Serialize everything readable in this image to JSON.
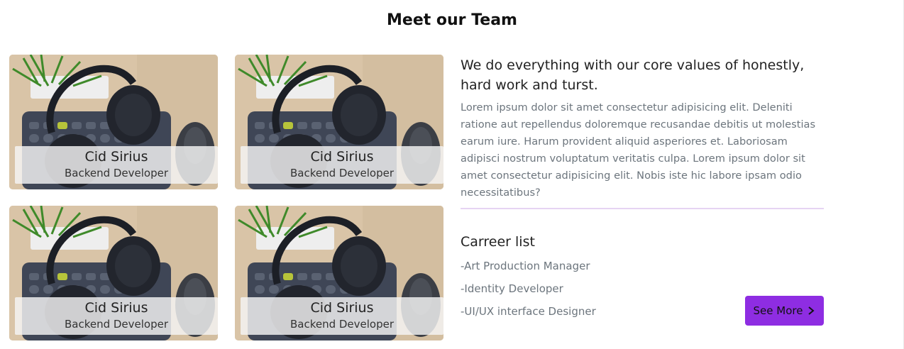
{
  "section": {
    "title": "Meet our Team"
  },
  "team": [
    {
      "name": "Cid Sirius",
      "role": "Backend Developer"
    },
    {
      "name": "Cid Sirius",
      "role": "Backend Developer"
    },
    {
      "name": "Cid Sirius",
      "role": "Backend Developer"
    },
    {
      "name": "Cid Sirius",
      "role": "Backend Developer"
    }
  ],
  "about": {
    "heading": "We do everything with our core values of honestly, hard work and turst.",
    "body": "Lorem ipsum dolor sit amet consectetur adipisicing elit. Deleniti ratione aut repellendus doloremque recusandae debitis ut molestias earum iure. Harum provident aliquid asperiores et. Laboriosam adipisci nostrum voluptatum veritatis culpa. Lorem ipsum dolor sit amet consectetur adipisicing elit. Nobis iste hic labore ipsam odio necessitatibus?"
  },
  "career": {
    "title": "Carreer list",
    "items": [
      "-Art Production Manager",
      "-Identity Developer",
      "-UI/UX interface Designer"
    ],
    "button_label": "See More"
  },
  "colors": {
    "accent": "#8e2de2",
    "divider": "#e6d4f3"
  }
}
